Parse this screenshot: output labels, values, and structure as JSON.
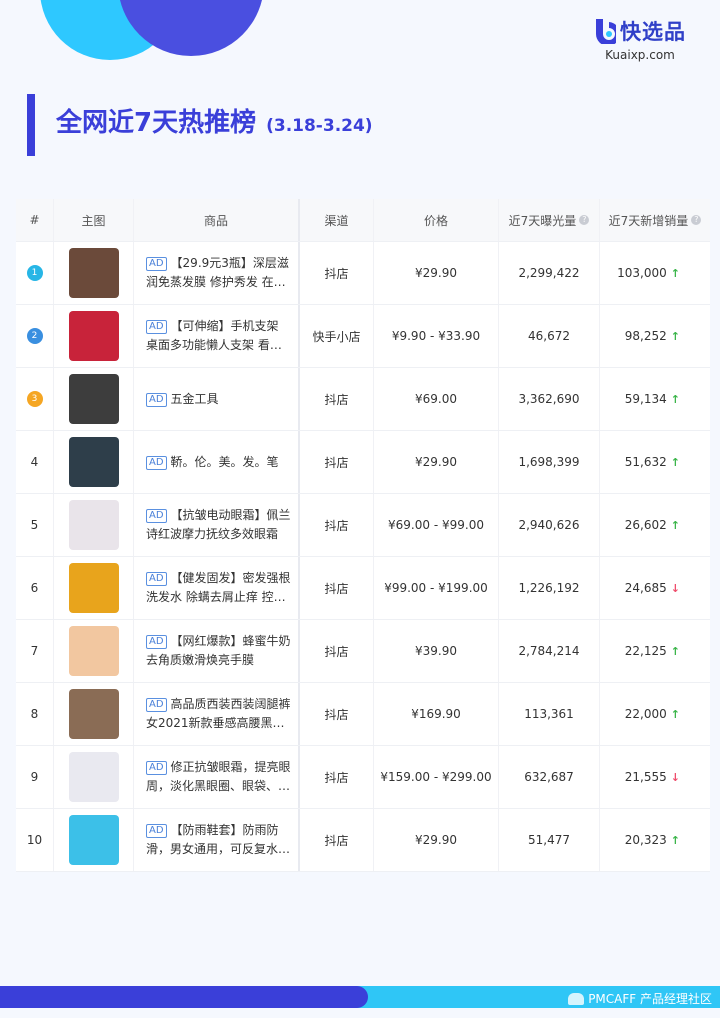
{
  "brand": {
    "name": "快选品",
    "url": "Kuaixp.com"
  },
  "title": {
    "main": "全网近7天热推榜",
    "date": "(3.18-3.24)"
  },
  "table": {
    "headers": {
      "rank": "#",
      "image": "主图",
      "product": "商品",
      "channel": "渠道",
      "price": "价格",
      "exposure": "近7天曝光量",
      "sales": "近7天新增销量"
    },
    "ad_label": "AD",
    "rows": [
      {
        "rank": "1",
        "name": "【29.9元3瓶】深层滋润免蒸发膜 修护秀发 在家…",
        "channel": "抖店",
        "price": "¥29.90",
        "exposure": "2,299,422",
        "sales": "103,000",
        "trend": "up",
        "img": "#6b4a3a",
        "badge": "#27b6e6"
      },
      {
        "rank": "2",
        "name": "【可伸缩】手机支架 桌面多功能懒人支架 看电视…",
        "channel": "快手小店",
        "price": "¥9.90 - ¥33.90",
        "exposure": "46,672",
        "sales": "98,252",
        "trend": "up",
        "img": "#c8233a",
        "badge": "#3a8fe0"
      },
      {
        "rank": "3",
        "name": "五金工具",
        "channel": "抖店",
        "price": "¥69.00",
        "exposure": "3,362,690",
        "sales": "59,134",
        "trend": "up",
        "img": "#3d3d3d",
        "badge": "#f5a623"
      },
      {
        "rank": "4",
        "name": "鞒。伦。美。发。笔",
        "channel": "抖店",
        "price": "¥29.90",
        "exposure": "1,698,399",
        "sales": "51,632",
        "trend": "up",
        "img": "#2e3e4a",
        "badge": ""
      },
      {
        "rank": "5",
        "name": "【抗皱电动眼霜】佩兰诗红波摩力抚纹多效眼霜",
        "channel": "抖店",
        "price": "¥69.00 - ¥99.00",
        "exposure": "2,940,626",
        "sales": "26,602",
        "trend": "up",
        "img": "#e9e4ea",
        "badge": ""
      },
      {
        "rank": "6",
        "name": "【健发固发】密发强根洗发水 除螨去屑止痒 控油…",
        "channel": "抖店",
        "price": "¥99.00 - ¥199.00",
        "exposure": "1,226,192",
        "sales": "24,685",
        "trend": "down",
        "img": "#e8a41c",
        "badge": ""
      },
      {
        "rank": "7",
        "name": "【网红爆款】蜂蜜牛奶去角质嫩滑焕亮手膜",
        "channel": "抖店",
        "price": "¥39.90",
        "exposure": "2,784,214",
        "sales": "22,125",
        "trend": "up",
        "img": "#f2c7a0",
        "badge": ""
      },
      {
        "rank": "8",
        "name": "高品质西装西装阔腿裤女2021新款垂感高腰黑色…",
        "channel": "抖店",
        "price": "¥169.90",
        "exposure": "113,361",
        "sales": "22,000",
        "trend": "up",
        "img": "#8a6c55",
        "badge": ""
      },
      {
        "rank": "9",
        "name": "修正抗皱眼霜，提亮眼周，淡化黑眼圈、眼袋、…",
        "channel": "抖店",
        "price": "¥159.00 - ¥299.00",
        "exposure": "632,687",
        "sales": "21,555",
        "trend": "down",
        "img": "#e9e9f0",
        "badge": ""
      },
      {
        "rank": "10",
        "name": "【防雨鞋套】防雨防滑，男女通用，可反复水…",
        "channel": "抖店",
        "price": "¥29.90",
        "exposure": "51,477",
        "sales": "20,323",
        "trend": "up",
        "img": "#3cc0e8",
        "badge": ""
      }
    ]
  },
  "footer": {
    "brand": "PMCAFF 产品经理社区"
  }
}
